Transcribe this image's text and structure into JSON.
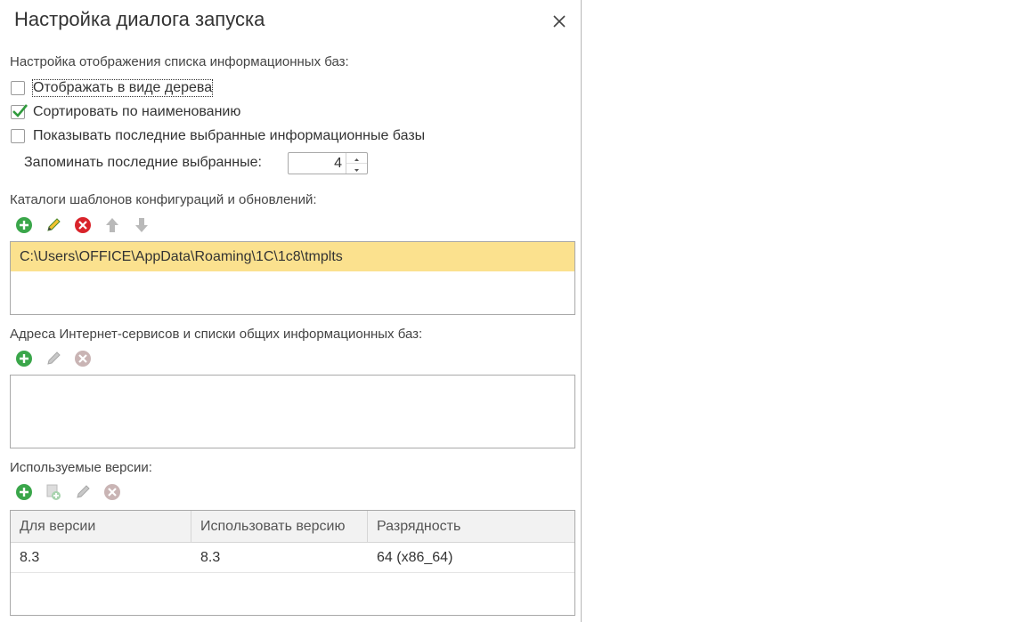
{
  "dialog": {
    "title": "Настройка диалога запуска"
  },
  "display_settings": {
    "label": "Настройка отображения списка информационных баз:",
    "options": [
      {
        "label": "Отображать в виде дерева",
        "checked": false
      },
      {
        "label": "Сортировать по наименованию",
        "checked": true
      },
      {
        "label": "Показывать последние выбранные информационные базы",
        "checked": false
      }
    ],
    "remember_label": "Запоминать последние выбранные:",
    "remember_value": "4"
  },
  "templates": {
    "label": "Каталоги шаблонов конфигураций и обновлений:",
    "items": [
      "C:\\Users\\OFFICE\\AppData\\Roaming\\1C\\1c8\\tmplts"
    ]
  },
  "internet_services": {
    "label": "Адреса Интернет-сервисов и списки общих информационных баз:"
  },
  "versions": {
    "label": "Используемые версии:",
    "columns": [
      "Для версии",
      "Использовать версию",
      "Разрядность"
    ],
    "rows": [
      [
        "8.3",
        "8.3",
        "64 (x86_64)"
      ]
    ]
  },
  "colors": {
    "accent_green": "#3aa64a",
    "delete_red": "#d9242b",
    "edit_yellow": "#f2c12e",
    "selection": "#fbe18e",
    "disabled": "#b9b9b9"
  }
}
